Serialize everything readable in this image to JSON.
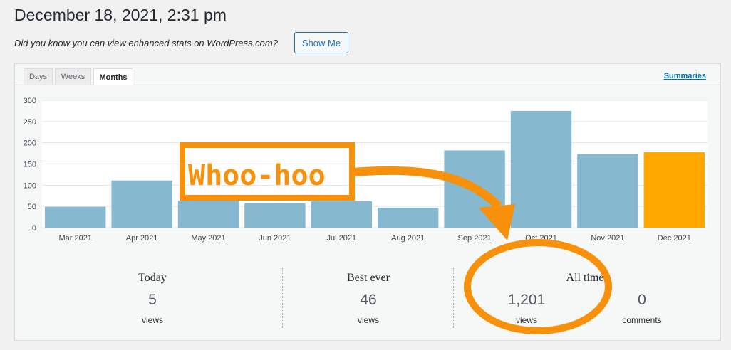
{
  "header": {
    "title": "December 18, 2021, 2:31 pm",
    "notice": "Did you know you can view enhanced stats on WordPress.com?",
    "show_me_label": "Show Me"
  },
  "tabs": [
    {
      "label": "Days",
      "active": false
    },
    {
      "label": "Weeks",
      "active": false
    },
    {
      "label": "Months",
      "active": true
    }
  ],
  "summaries_link": "Summaries",
  "chart_data": {
    "type": "bar",
    "categories": [
      "Mar 2021",
      "Apr 2021",
      "May 2021",
      "Jun 2021",
      "Jul 2021",
      "Aug 2021",
      "Sep 2021",
      "Oct 2021",
      "Nov 2021",
      "Dec 2021"
    ],
    "values": [
      49,
      111,
      63,
      57,
      62,
      47,
      182,
      275,
      173,
      178
    ],
    "highlight_index": 9,
    "bar_color": "#86b8d0",
    "highlight_color": "#ffa800",
    "ylim": [
      0,
      300
    ],
    "yticks": [
      0,
      50,
      100,
      150,
      200,
      250,
      300
    ],
    "grid": true,
    "title": "",
    "xlabel": "",
    "ylabel": ""
  },
  "annotation": {
    "text": "Whoo-hoo",
    "color": "#f7900a"
  },
  "stats": {
    "today": {
      "label": "Today",
      "value": "5",
      "unit": "views"
    },
    "best_ever": {
      "label": "Best ever",
      "value": "46",
      "unit": "views"
    },
    "all_time": {
      "label": "All time",
      "views_value": "1,201",
      "views_unit": "views",
      "comments_value": "0",
      "comments_unit": "comments"
    }
  }
}
